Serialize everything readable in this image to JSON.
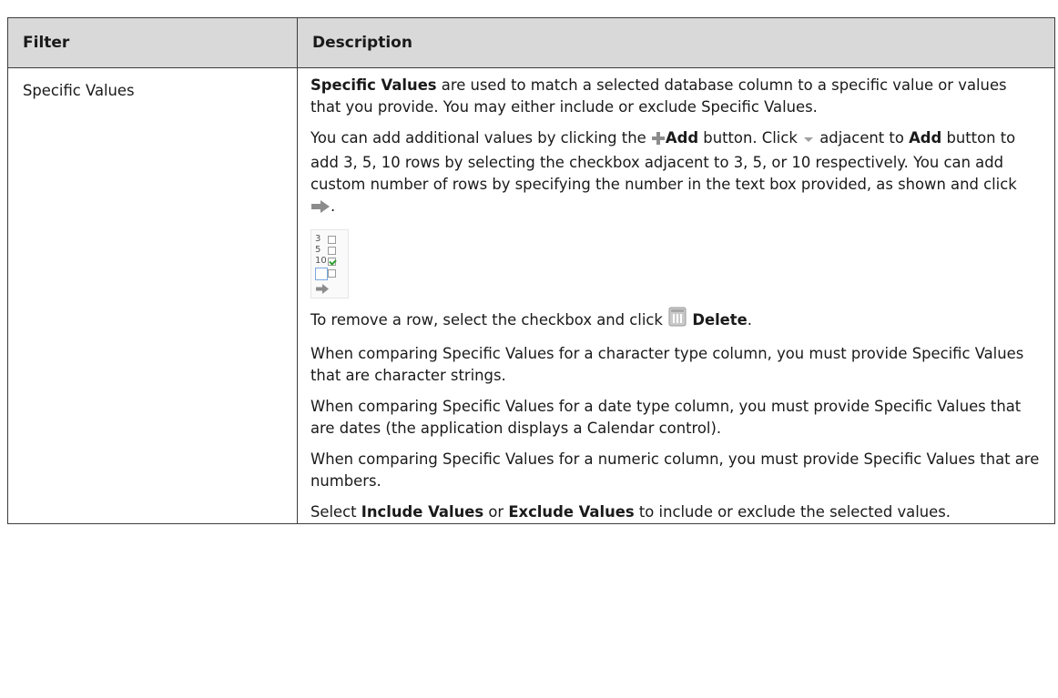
{
  "table": {
    "headers": {
      "filter": "Filter",
      "description": "Description"
    },
    "row": {
      "filter": "Specific Values",
      "p1": {
        "bold": "Specific Values",
        "text": " are used to match a selected database column to a specific value or values that you provide. You may either include or exclude Specific Values."
      },
      "p2": {
        "t1": "You can add additional values by clicking the ",
        "add_bold": "Add",
        "t2": " button. Click ",
        "t3": " adjacent to ",
        "add_bold2": "Add",
        "t4": " button to add 3, 5, 10 rows by selecting the checkbox adjacent to 3, 5, or 10 respectively. You can add custom number of rows by specifying the number in the text box provided, as shown and click ",
        "t5": "."
      },
      "rows_widget": {
        "options": [
          {
            "label": "3",
            "checked": false
          },
          {
            "label": "5",
            "checked": false
          },
          {
            "label": "10",
            "checked": true
          }
        ]
      },
      "p3": {
        "t1": "To remove a row, select the checkbox and click ",
        "delete_bold": "Delete",
        "t2": "."
      },
      "p4": "When comparing Specific Values for a character type column, you must provide Specific Values that are character strings.",
      "p5": "When comparing Specific Values for a date type column, you must provide Specific Values that are dates (the application displays a Calendar control).",
      "p6": "When comparing Specific Values for a numeric column, you must provide Specific Values that are numbers.",
      "p7": {
        "t1": "Select ",
        "include_bold": "Include Values",
        "t2": " or ",
        "exclude_bold": "Exclude Values",
        "t3": " to include or exclude the selected values."
      }
    }
  },
  "icons": {
    "add": "plus-icon",
    "dropdown": "dropdown-arrow-icon",
    "go": "right-arrow-icon",
    "delete": "trash-icon"
  },
  "colors": {
    "header_bg": "#d9d9d9",
    "border": "#3c3c3c",
    "icon_gray": "#8c8c8c"
  }
}
